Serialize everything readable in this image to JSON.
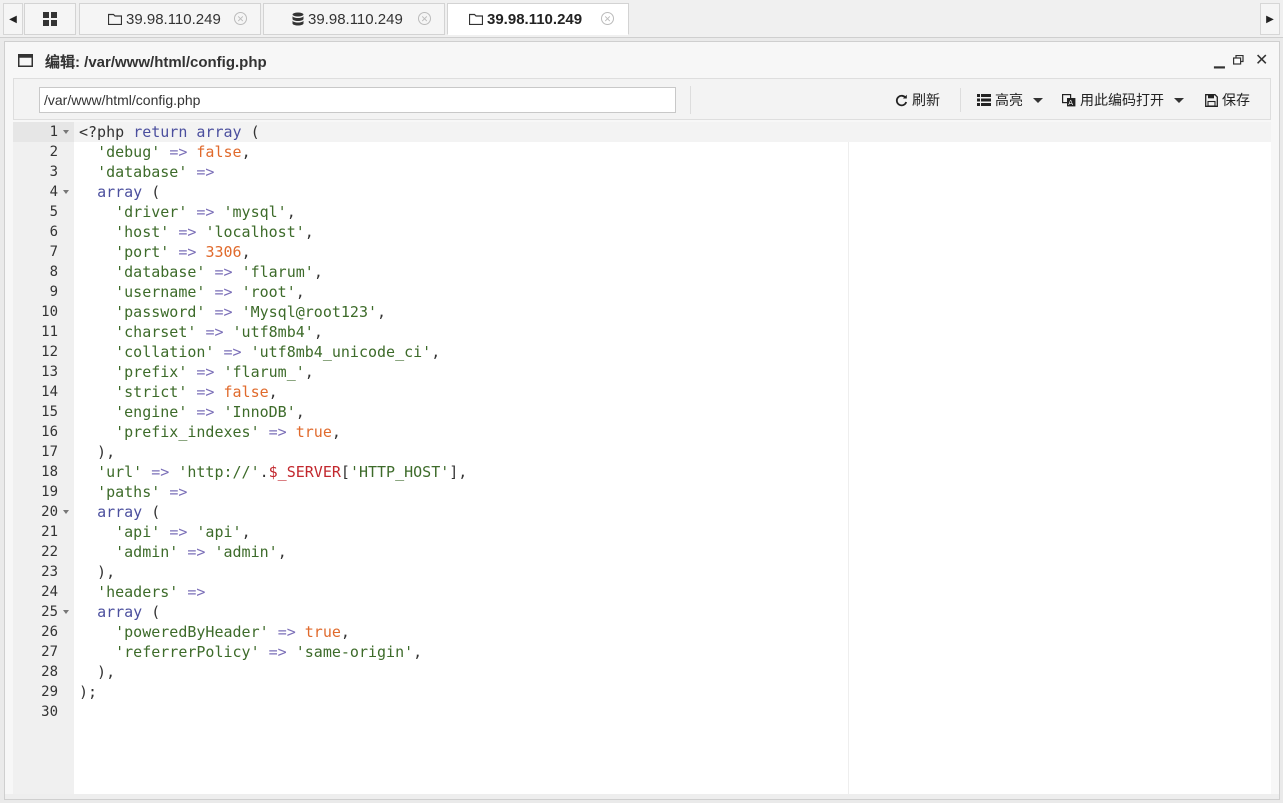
{
  "tabs": [
    {
      "label": "39.98.110.249",
      "icon": "folder-icon"
    },
    {
      "label": "39.98.110.249",
      "icon": "database-icon"
    },
    {
      "label": "39.98.110.249",
      "icon": "folder-icon",
      "active": true
    }
  ],
  "window": {
    "title": "编辑: /var/www/html/config.php"
  },
  "toolbar": {
    "path_value": "/var/www/html/config.php",
    "refresh_label": "刷新",
    "highlight_label": "高亮",
    "encoding_label": "用此编码打开",
    "save_label": "保存"
  },
  "editor": {
    "active_line": 1,
    "lines": [
      [
        [
          "p",
          "<?php "
        ],
        [
          "k",
          "return "
        ],
        [
          "k",
          "array"
        ],
        [
          "p",
          " ("
        ]
      ],
      [
        [
          "p",
          "  "
        ],
        [
          "s",
          "'debug'"
        ],
        [
          "p",
          " "
        ],
        [
          "o",
          "=>"
        ],
        [
          "p",
          " "
        ],
        [
          "n2",
          "false"
        ],
        [
          "p",
          ","
        ]
      ],
      [
        [
          "p",
          "  "
        ],
        [
          "s",
          "'database'"
        ],
        [
          "p",
          " "
        ],
        [
          "o",
          "=>"
        ]
      ],
      [
        [
          "p",
          "  "
        ],
        [
          "k",
          "array"
        ],
        [
          "p",
          " ("
        ]
      ],
      [
        [
          "p",
          "    "
        ],
        [
          "s",
          "'driver'"
        ],
        [
          "p",
          " "
        ],
        [
          "o",
          "=>"
        ],
        [
          "p",
          " "
        ],
        [
          "s",
          "'mysql'"
        ],
        [
          "p",
          ","
        ]
      ],
      [
        [
          "p",
          "    "
        ],
        [
          "s",
          "'host'"
        ],
        [
          "p",
          " "
        ],
        [
          "o",
          "=>"
        ],
        [
          "p",
          " "
        ],
        [
          "s",
          "'localhost'"
        ],
        [
          "p",
          ","
        ]
      ],
      [
        [
          "p",
          "    "
        ],
        [
          "s",
          "'port'"
        ],
        [
          "p",
          " "
        ],
        [
          "o",
          "=>"
        ],
        [
          "p",
          " "
        ],
        [
          "n2",
          "3306"
        ],
        [
          "p",
          ","
        ]
      ],
      [
        [
          "p",
          "    "
        ],
        [
          "s",
          "'database'"
        ],
        [
          "p",
          " "
        ],
        [
          "o",
          "=>"
        ],
        [
          "p",
          " "
        ],
        [
          "s",
          "'flarum'"
        ],
        [
          "p",
          ","
        ]
      ],
      [
        [
          "p",
          "    "
        ],
        [
          "s",
          "'username'"
        ],
        [
          "p",
          " "
        ],
        [
          "o",
          "=>"
        ],
        [
          "p",
          " "
        ],
        [
          "s",
          "'root'"
        ],
        [
          "p",
          ","
        ]
      ],
      [
        [
          "p",
          "    "
        ],
        [
          "s",
          "'password'"
        ],
        [
          "p",
          " "
        ],
        [
          "o",
          "=>"
        ],
        [
          "p",
          " "
        ],
        [
          "s",
          "'Mysql@root123'"
        ],
        [
          "p",
          ","
        ]
      ],
      [
        [
          "p",
          "    "
        ],
        [
          "s",
          "'charset'"
        ],
        [
          "p",
          " "
        ],
        [
          "o",
          "=>"
        ],
        [
          "p",
          " "
        ],
        [
          "s",
          "'utf8mb4'"
        ],
        [
          "p",
          ","
        ]
      ],
      [
        [
          "p",
          "    "
        ],
        [
          "s",
          "'collation'"
        ],
        [
          "p",
          " "
        ],
        [
          "o",
          "=>"
        ],
        [
          "p",
          " "
        ],
        [
          "s",
          "'utf8mb4_unicode_ci'"
        ],
        [
          "p",
          ","
        ]
      ],
      [
        [
          "p",
          "    "
        ],
        [
          "s",
          "'prefix'"
        ],
        [
          "p",
          " "
        ],
        [
          "o",
          "=>"
        ],
        [
          "p",
          " "
        ],
        [
          "s",
          "'flarum_'"
        ],
        [
          "p",
          ","
        ]
      ],
      [
        [
          "p",
          "    "
        ],
        [
          "s",
          "'strict'"
        ],
        [
          "p",
          " "
        ],
        [
          "o",
          "=>"
        ],
        [
          "p",
          " "
        ],
        [
          "n2",
          "false"
        ],
        [
          "p",
          ","
        ]
      ],
      [
        [
          "p",
          "    "
        ],
        [
          "s",
          "'engine'"
        ],
        [
          "p",
          " "
        ],
        [
          "o",
          "=>"
        ],
        [
          "p",
          " "
        ],
        [
          "s",
          "'InnoDB'"
        ],
        [
          "p",
          ","
        ]
      ],
      [
        [
          "p",
          "    "
        ],
        [
          "s",
          "'prefix_indexes'"
        ],
        [
          "p",
          " "
        ],
        [
          "o",
          "=>"
        ],
        [
          "p",
          " "
        ],
        [
          "n2",
          "true"
        ],
        [
          "p",
          ","
        ]
      ],
      [
        [
          "p",
          "  ),"
        ]
      ],
      [
        [
          "p",
          "  "
        ],
        [
          "s",
          "'url'"
        ],
        [
          "p",
          " "
        ],
        [
          "o",
          "=>"
        ],
        [
          "p",
          " "
        ],
        [
          "s",
          "'http://'"
        ],
        [
          "p",
          "."
        ],
        [
          "v",
          "$_SERVER"
        ],
        [
          "p",
          "["
        ],
        [
          "s",
          "'HTTP_HOST'"
        ],
        [
          "p",
          "],"
        ]
      ],
      [
        [
          "p",
          "  "
        ],
        [
          "s",
          "'paths'"
        ],
        [
          "p",
          " "
        ],
        [
          "o",
          "=>"
        ]
      ],
      [
        [
          "p",
          "  "
        ],
        [
          "k",
          "array"
        ],
        [
          "p",
          " ("
        ]
      ],
      [
        [
          "p",
          "    "
        ],
        [
          "s",
          "'api'"
        ],
        [
          "p",
          " "
        ],
        [
          "o",
          "=>"
        ],
        [
          "p",
          " "
        ],
        [
          "s",
          "'api'"
        ],
        [
          "p",
          ","
        ]
      ],
      [
        [
          "p",
          "    "
        ],
        [
          "s",
          "'admin'"
        ],
        [
          "p",
          " "
        ],
        [
          "o",
          "=>"
        ],
        [
          "p",
          " "
        ],
        [
          "s",
          "'admin'"
        ],
        [
          "p",
          ","
        ]
      ],
      [
        [
          "p",
          "  ),"
        ]
      ],
      [
        [
          "p",
          "  "
        ],
        [
          "s",
          "'headers'"
        ],
        [
          "p",
          " "
        ],
        [
          "o",
          "=>"
        ]
      ],
      [
        [
          "p",
          "  "
        ],
        [
          "k",
          "array"
        ],
        [
          "p",
          " ("
        ]
      ],
      [
        [
          "p",
          "    "
        ],
        [
          "s",
          "'poweredByHeader'"
        ],
        [
          "p",
          " "
        ],
        [
          "o",
          "=>"
        ],
        [
          "p",
          " "
        ],
        [
          "n2",
          "true"
        ],
        [
          "p",
          ","
        ]
      ],
      [
        [
          "p",
          "    "
        ],
        [
          "s",
          "'referrerPolicy'"
        ],
        [
          "p",
          " "
        ],
        [
          "o",
          "=>"
        ],
        [
          "p",
          " "
        ],
        [
          "s",
          "'same-origin'"
        ],
        [
          "p",
          ","
        ]
      ],
      [
        [
          "p",
          "  ),"
        ]
      ],
      [
        [
          "p",
          ");"
        ]
      ],
      []
    ],
    "fold_lines": [
      1,
      4,
      20,
      25
    ]
  }
}
